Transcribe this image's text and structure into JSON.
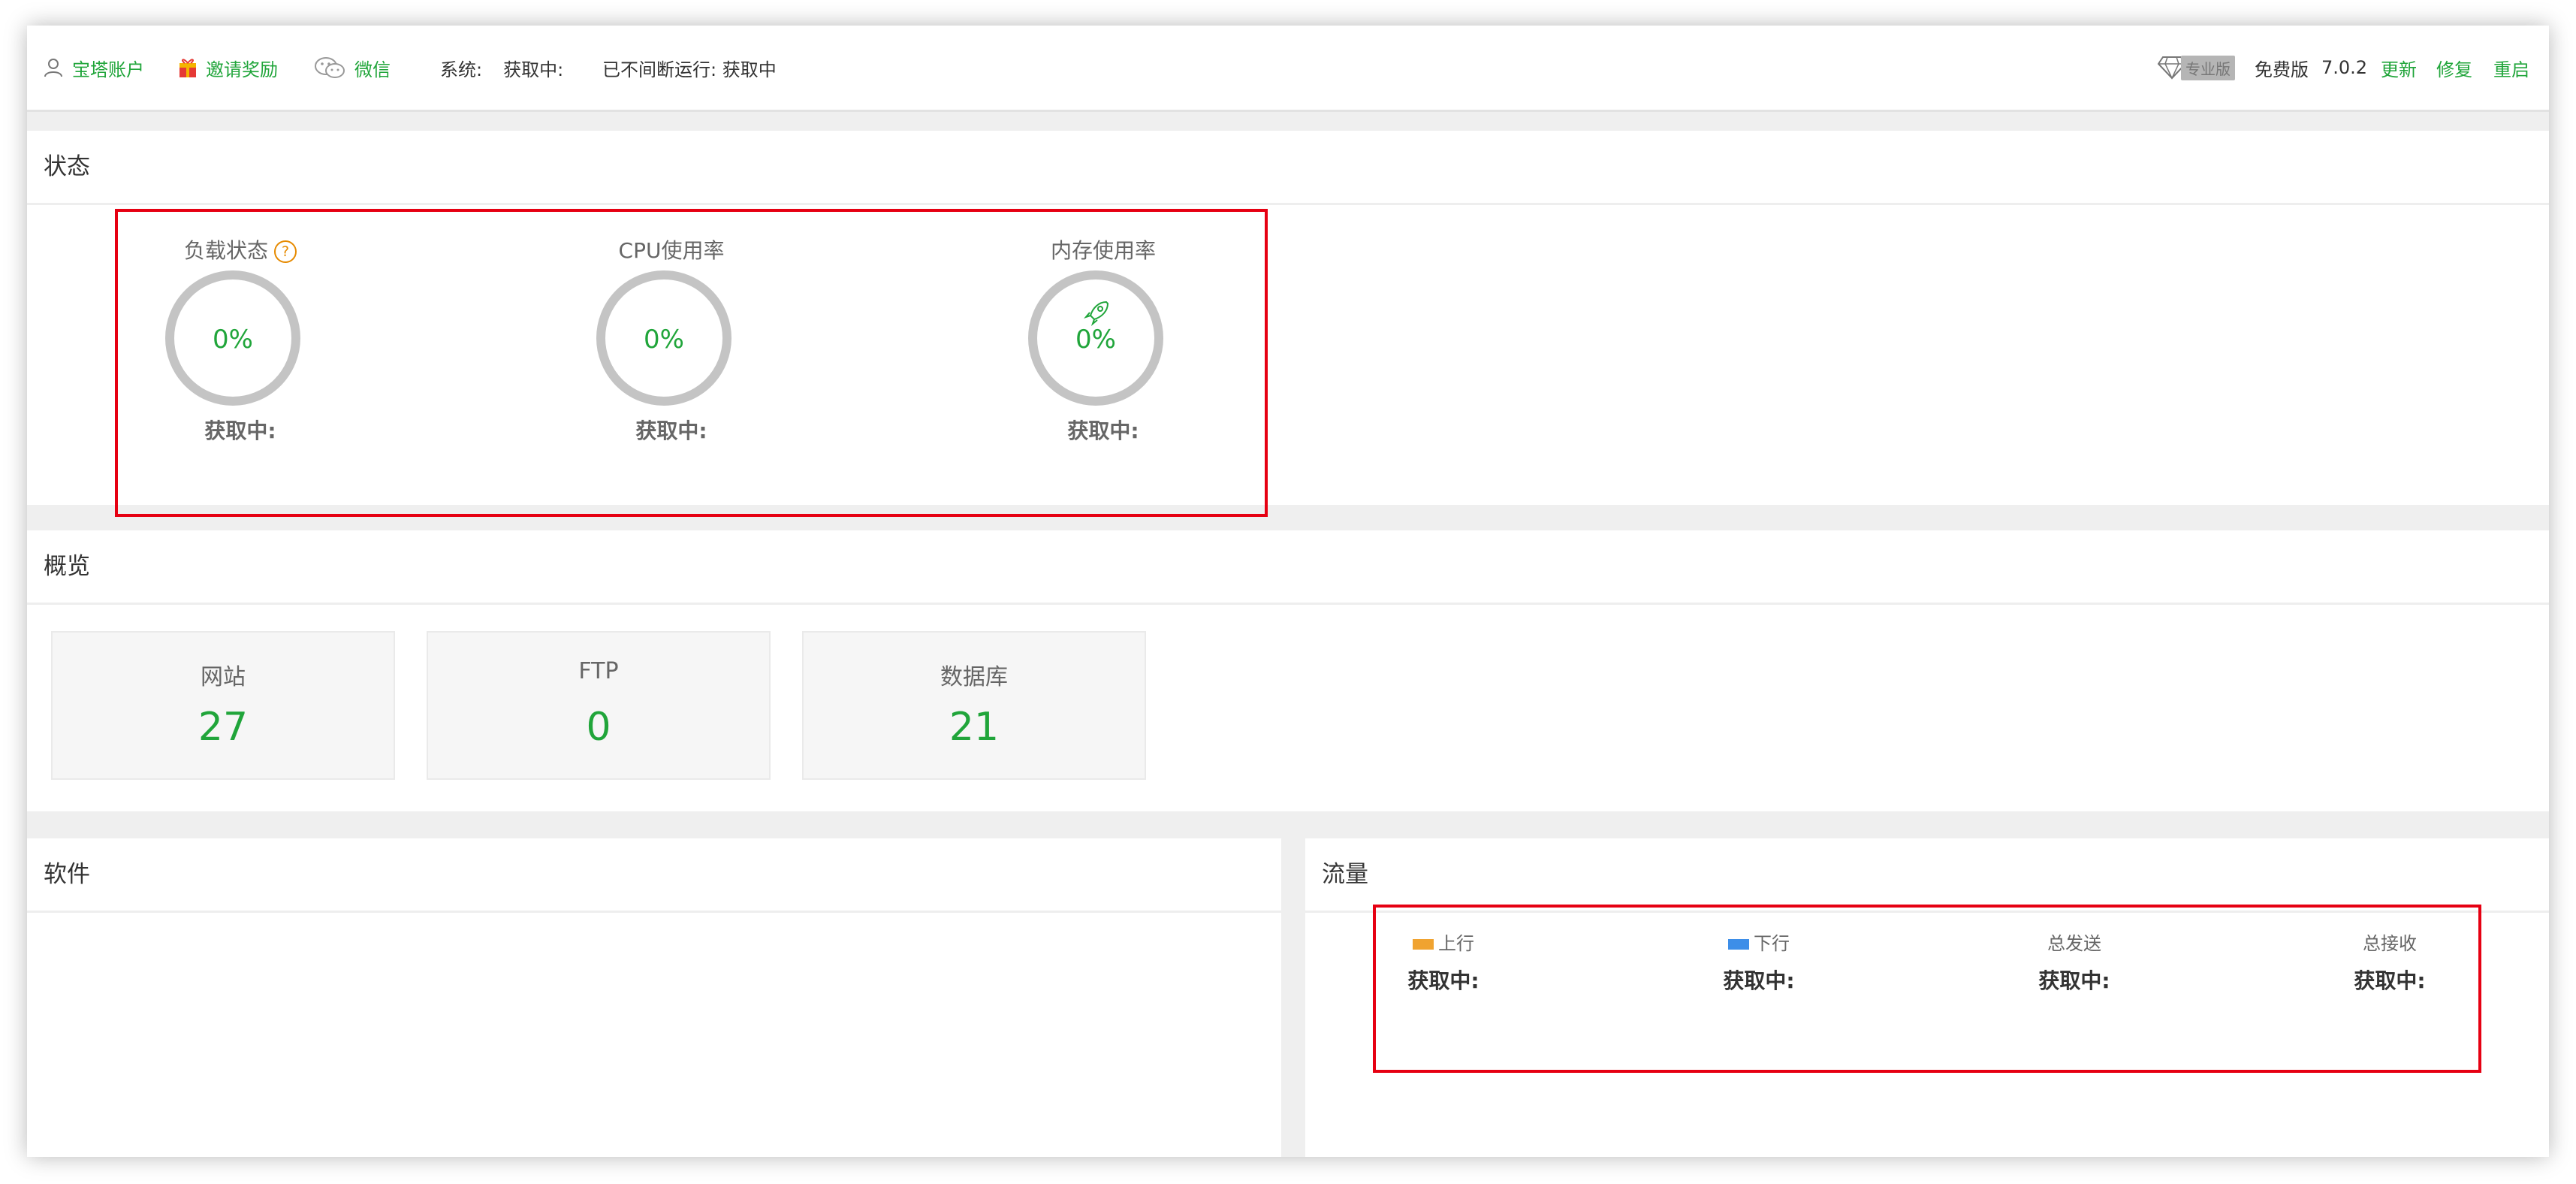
{
  "topbar": {
    "account": "宝塔账户",
    "invite": "邀请奖励",
    "wechat": "微信",
    "system_label": "系统:",
    "system_value": "获取中:",
    "uptime": "已不间断运行: 获取中",
    "pro_badge": "专业版",
    "edition": "免费版",
    "version": "7.0.2",
    "update": "更新",
    "repair": "修复",
    "restart": "重启"
  },
  "status": {
    "title": "状态",
    "gauges": [
      {
        "label": "负载状态",
        "value": "0%",
        "sub": "获取中:",
        "help": "?"
      },
      {
        "label": "CPU使用率",
        "value": "0%",
        "sub": "获取中:"
      },
      {
        "label": "内存使用率",
        "value": "0%",
        "sub": "获取中:",
        "icon": "rocket-icon"
      }
    ]
  },
  "overview": {
    "title": "概览",
    "cards": [
      {
        "label": "网站",
        "value": "27"
      },
      {
        "label": "FTP",
        "value": "0"
      },
      {
        "label": "数据库",
        "value": "21"
      }
    ]
  },
  "software": {
    "title": "软件"
  },
  "traffic": {
    "title": "流量",
    "columns": [
      {
        "label": "上行",
        "value": "获取中:",
        "color": "#f0a330"
      },
      {
        "label": "下行",
        "value": "获取中:",
        "color": "#3d8ee8"
      },
      {
        "label": "总发送",
        "value": "获取中:"
      },
      {
        "label": "总接收",
        "value": "获取中:"
      }
    ]
  },
  "colors": {
    "accent": "#20a53a",
    "highlight_box": "#e60012",
    "help": "#e68a00"
  }
}
